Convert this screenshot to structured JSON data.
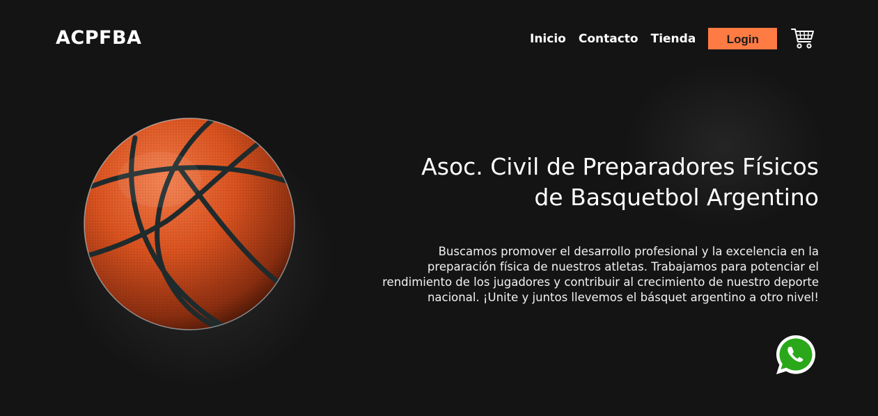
{
  "brand": {
    "logo_text": "ACPFBA"
  },
  "nav": {
    "items": [
      {
        "label": "Inicio"
      },
      {
        "label": "Contacto"
      },
      {
        "label": "Tienda"
      }
    ],
    "login_label": "Login",
    "cart_icon": "shopping-cart-icon"
  },
  "hero": {
    "title_line1": "Asoc. Civil de Preparadores Físicos",
    "title_line2": "de Basquetbol Argentino",
    "description": "Buscamos promover el desarrollo profesional y la excelencia en la preparación física de nuestros atletas. Trabajamos para potenciar el rendimiento de los jugadores y contribuir al crecimiento de nuestro deporte nacional. ¡Unite y juntos llevemos el básquet argentino a otro nivel!",
    "image": "basketball"
  },
  "floating": {
    "whatsapp_icon": "whatsapp-icon"
  },
  "colors": {
    "background": "#141414",
    "accent": "#ff7b44",
    "text": "#ffffff",
    "whatsapp_green": "#2aa81a"
  }
}
